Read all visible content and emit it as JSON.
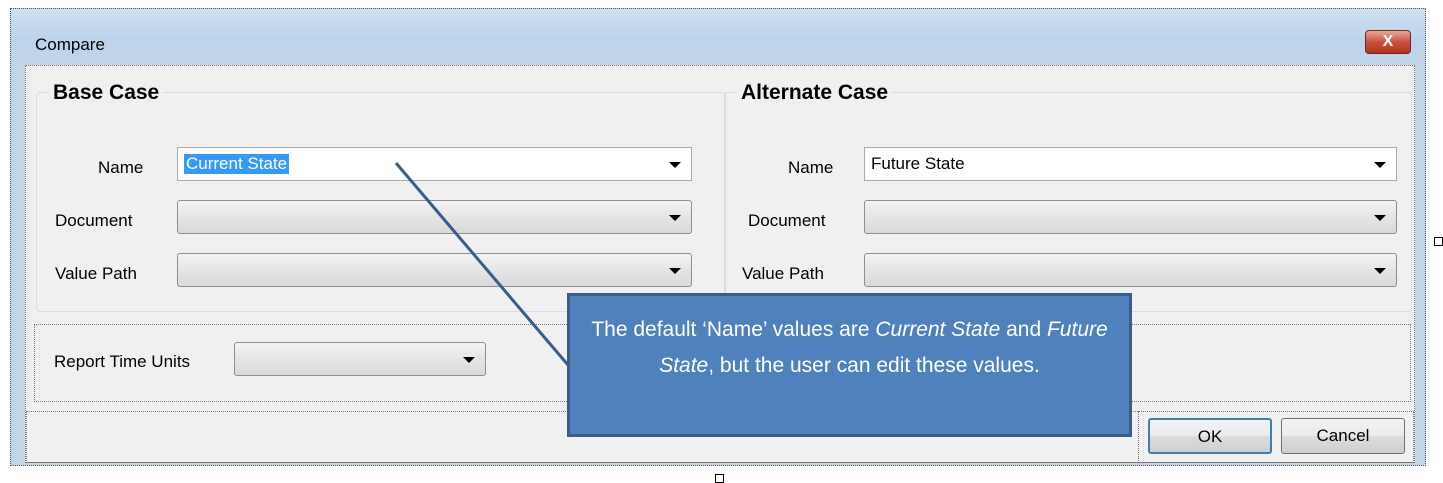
{
  "window": {
    "title": "Compare",
    "close_label": "X"
  },
  "base_case": {
    "heading": "Base Case",
    "name_label": "Name",
    "name_value": "Current State",
    "document_label": "Document",
    "document_value": "",
    "value_path_label": "Value Path",
    "value_path_value": ""
  },
  "alternate_case": {
    "heading": "Alternate Case",
    "name_label": "Name",
    "name_value": "Future State",
    "document_label": "Document",
    "document_value": "",
    "value_path_label": "Value Path",
    "value_path_value": ""
  },
  "report_time_units": {
    "label": "Report Time Units",
    "value": ""
  },
  "buttons": {
    "ok": "OK",
    "cancel": "Cancel"
  },
  "callout": {
    "part1": "The default ‘Name’ values are ",
    "current": "Current State",
    "part2": " and ",
    "future": "Future State",
    "part3": ", but the user can edit these values."
  },
  "colors": {
    "callout_fill": "#4f81bd",
    "selection": "#3399ff",
    "close_button": "#c8513c"
  }
}
